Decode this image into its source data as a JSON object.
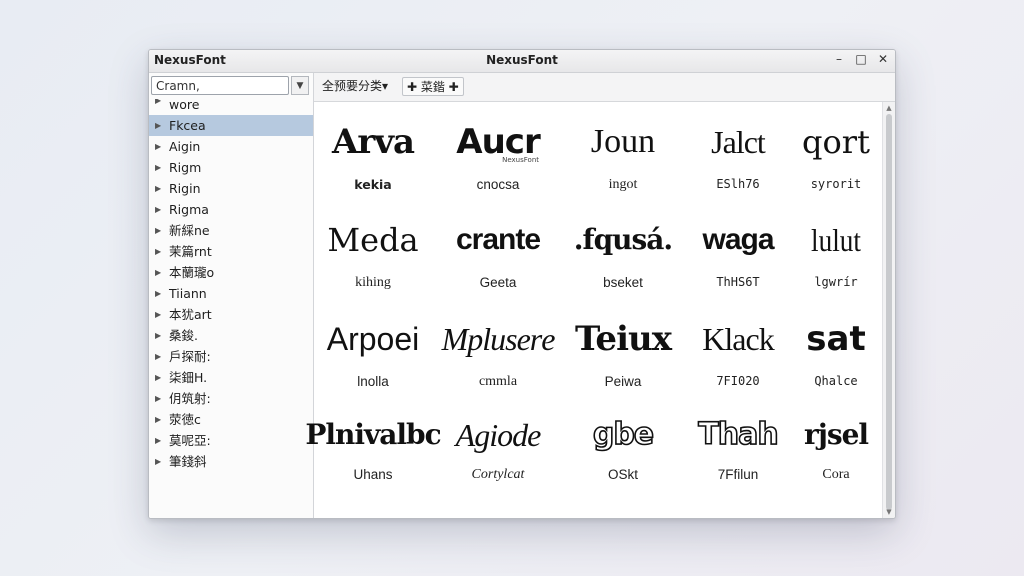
{
  "window": {
    "app_name": "NexusFont",
    "title": "NexusFont",
    "controls": {
      "minimize": "–",
      "maximize": "□",
      "close": "✕"
    }
  },
  "sidebar": {
    "search_value": "Cramn,",
    "dropdown_icon": "chevron-down-icon",
    "items": [
      {
        "label": "wore",
        "selected": false
      },
      {
        "label": "Fkcea",
        "selected": true
      },
      {
        "label": "Aigin",
        "selected": false
      },
      {
        "label": "Rigm",
        "selected": false
      },
      {
        "label": "Rigin",
        "selected": false
      },
      {
        "label": "Rigma",
        "selected": false
      },
      {
        "label": "新綵ne",
        "selected": false
      },
      {
        "label": "茉篇rnt",
        "selected": false
      },
      {
        "label": "本蘭瓏o",
        "selected": false
      },
      {
        "label": "Tiiann",
        "selected": false
      },
      {
        "label": "本犹art",
        "selected": false
      },
      {
        "label": "桑鋑.",
        "selected": false
      },
      {
        "label": "戶探耐:",
        "selected": false
      },
      {
        "label": "柒鈿H.",
        "selected": false
      },
      {
        "label": "仴筑射:",
        "selected": false
      },
      {
        "label": "荥徳c",
        "selected": false
      },
      {
        "label": "莫呢亞:",
        "selected": false
      },
      {
        "label": "筆錢斜",
        "selected": false
      }
    ]
  },
  "toolbar": {
    "filter_label": "全预要分类",
    "filter_arrow": "▾",
    "add_button_label": "✚ 菜鍇 ✚"
  },
  "grid": {
    "samples": [
      {
        "sample": "Arva",
        "name": "kekia",
        "sub": ""
      },
      {
        "sample": "Aucr",
        "name": "cnocsa",
        "sub": "NexusFont"
      },
      {
        "sample": "Joun",
        "name": "ingot",
        "sub": ""
      },
      {
        "sample": "Jalct",
        "name": "ESlh76",
        "sub": ""
      },
      {
        "sample": "qort",
        "name": "syrorit",
        "sub": ""
      },
      {
        "sample": "Meda",
        "name": "kihing",
        "sub": ""
      },
      {
        "sample": "crante",
        "name": "Geeta",
        "sub": ""
      },
      {
        "sample": ".fqusá.",
        "name": "bseket",
        "sub": ""
      },
      {
        "sample": "waga",
        "name": "ThHS6T",
        "sub": ""
      },
      {
        "sample": "lulut",
        "name": "lgwrír",
        "sub": ""
      },
      {
        "sample": "Arpoei",
        "name": "lnolla",
        "sub": ""
      },
      {
        "sample": "Mpluserе",
        "name": "cmmla",
        "sub": ""
      },
      {
        "sample": "Teiux",
        "name": "Peiwa",
        "sub": ""
      },
      {
        "sample": "Klack",
        "name": "7FI020",
        "sub": ""
      },
      {
        "sample": "sat",
        "name": "Qhalce",
        "sub": ""
      },
      {
        "sample": "Plnivalbc",
        "name": "Uhans",
        "sub": ""
      },
      {
        "sample": "Agiode",
        "name": "Cortylcat",
        "sub": ""
      },
      {
        "sample": "gbe",
        "name": "OSkt",
        "sub": ""
      },
      {
        "sample": "Thah",
        "name": "7Ffilun",
        "sub": ""
      },
      {
        "sample": "rjsel",
        "name": "Cora",
        "sub": ""
      }
    ]
  },
  "colors": {
    "selection": "#b6c9df",
    "background": "#e8ecf3",
    "window": "#fbfbfb"
  }
}
